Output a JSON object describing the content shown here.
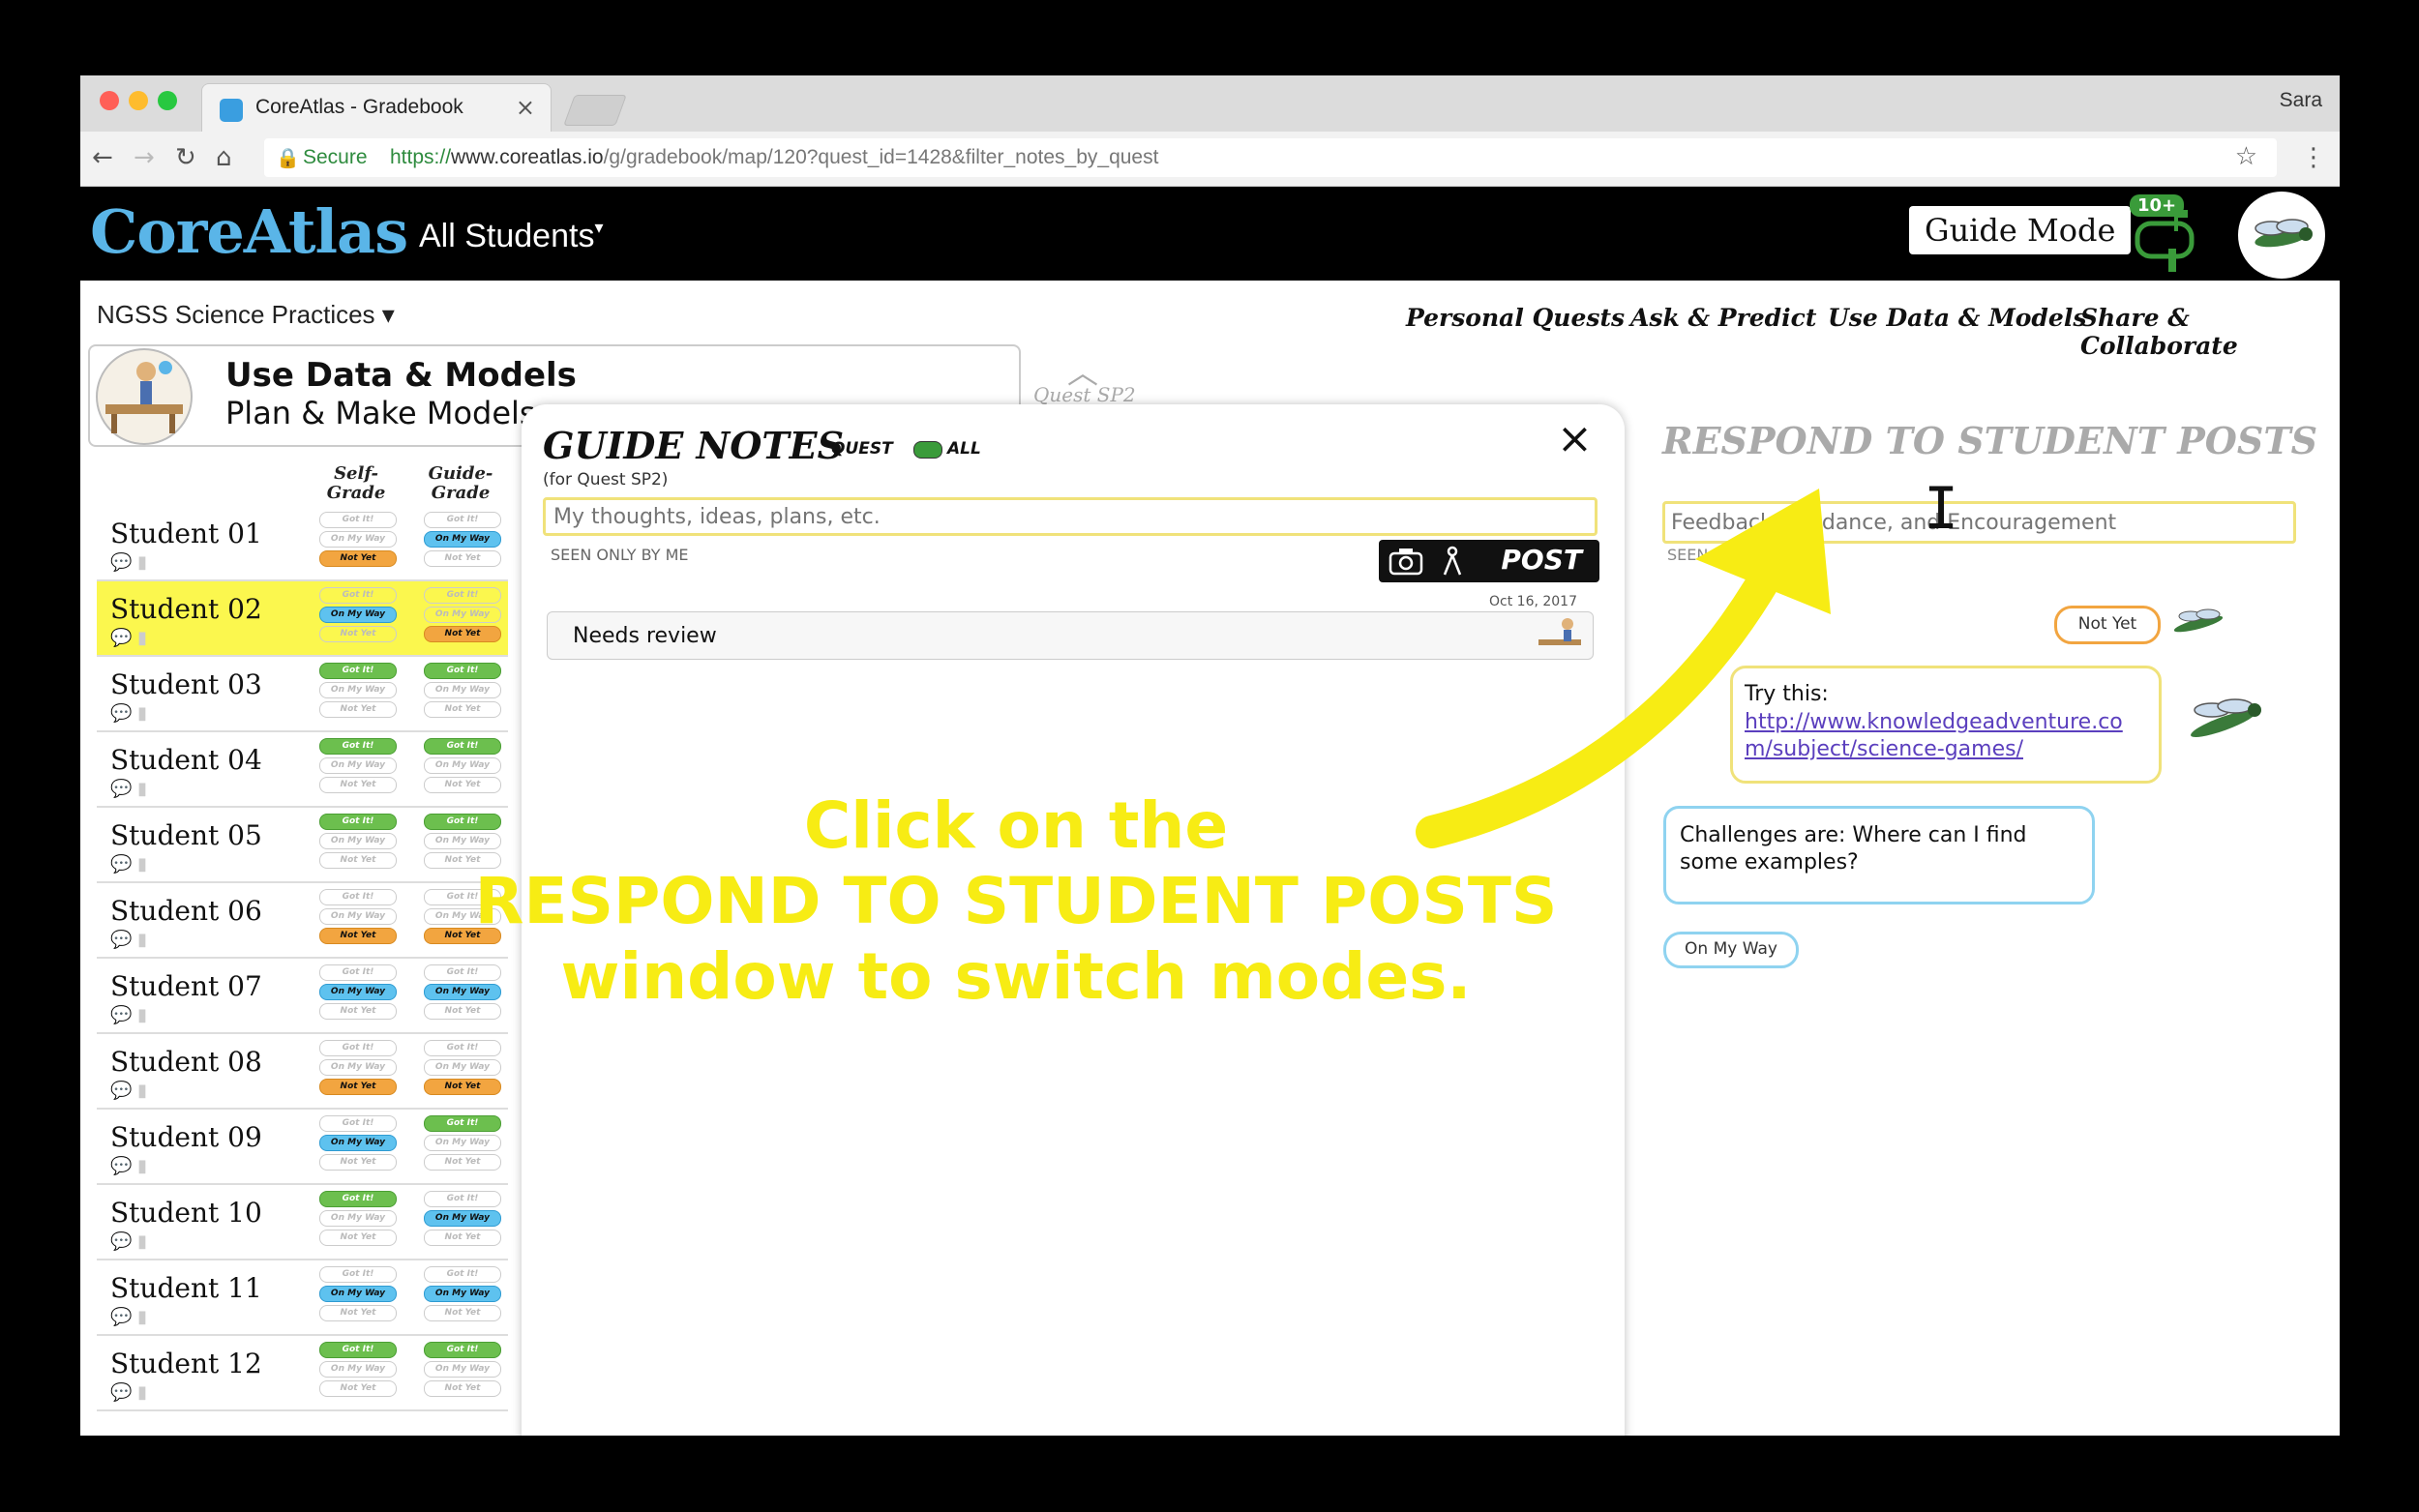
{
  "browser": {
    "tab_title": "CoreAtlas - Gradebook",
    "tab_close": "×",
    "profile": "Sara",
    "secure_label": "Secure",
    "url_scheme": "https://",
    "url_host": "www.coreatlas.io",
    "url_path": "/g/gradebook/map/120?quest_id=1428&filter_notes_by_quest"
  },
  "app": {
    "logo": "CoreAtlas",
    "scope_selector": "All Students",
    "guide_mode_button": "Guide Mode",
    "notification_badge": "10+"
  },
  "standards_dropdown": "NGSS Science Practices",
  "top_nav": [
    "Personal Quests",
    "Ask & Predict",
    "Use Data & Models",
    "Share & Collaborate"
  ],
  "quest": {
    "title": "Use Data & Models",
    "subtitle": "Plan & Make Models",
    "code": "Quest SP2"
  },
  "grade_columns": {
    "self": "Self-Grade",
    "self_line1": "Self-",
    "self_line2": "Grade",
    "guide_line1": "Guide-",
    "guide_line2": "Grade"
  },
  "grade_labels": {
    "got": "Got It!",
    "omw": "On My Way",
    "nyt": "Not Yet"
  },
  "students": [
    {
      "name": "Student 01",
      "self": "nyt",
      "guide": "omw"
    },
    {
      "name": "Student 02",
      "self": "omw",
      "guide": "nyt",
      "highlighted": true
    },
    {
      "name": "Student 03",
      "self": "got",
      "guide": "got"
    },
    {
      "name": "Student 04",
      "self": "got",
      "guide": "got"
    },
    {
      "name": "Student 05",
      "self": "got",
      "guide": "got"
    },
    {
      "name": "Student 06",
      "self": "nyt",
      "guide": "nyt"
    },
    {
      "name": "Student 07",
      "self": "omw",
      "guide": "omw"
    },
    {
      "name": "Student 08",
      "self": "nyt",
      "guide": "nyt"
    },
    {
      "name": "Student 09",
      "self": "omw",
      "guide": "got"
    },
    {
      "name": "Student 10",
      "self": "got",
      "guide": "omw"
    },
    {
      "name": "Student 11",
      "self": "omw",
      "guide": "omw"
    },
    {
      "name": "Student 12",
      "self": "got",
      "guide": "got"
    }
  ],
  "guide_notes": {
    "title": "GUIDE NOTES",
    "subtitle": "(for Quest SP2)",
    "toggle_left": "QUEST",
    "toggle_right": "ALL",
    "close": "×",
    "input_placeholder": "My thoughts, ideas, plans, etc.",
    "seen_label": "SEEN ONLY BY ME",
    "post_button": "POST",
    "note_date": "Oct 16, 2017",
    "note_text": "Needs review"
  },
  "respond": {
    "title": "RESPOND TO STUDENT POSTS",
    "input_placeholder": "Feedback, Guidance, and Encouragement",
    "seen_label": "SEEN",
    "status_badge": "Not Yet",
    "reply_label": "Try this:",
    "reply_link": "http://www.knowledgeadventure.com/subject/science-games/",
    "student_post": "Challenges are: Where can I find some examples?",
    "student_status": "On My Way"
  },
  "overlay": {
    "line1": "Click on the",
    "line2": "RESPOND TO STUDENT POSTS",
    "line3": "window to switch modes."
  },
  "colors": {
    "accent_yellow": "#f7ec14",
    "got": "#6cbf4e",
    "omw": "#5ec2ef",
    "nyt": "#f2a540"
  }
}
